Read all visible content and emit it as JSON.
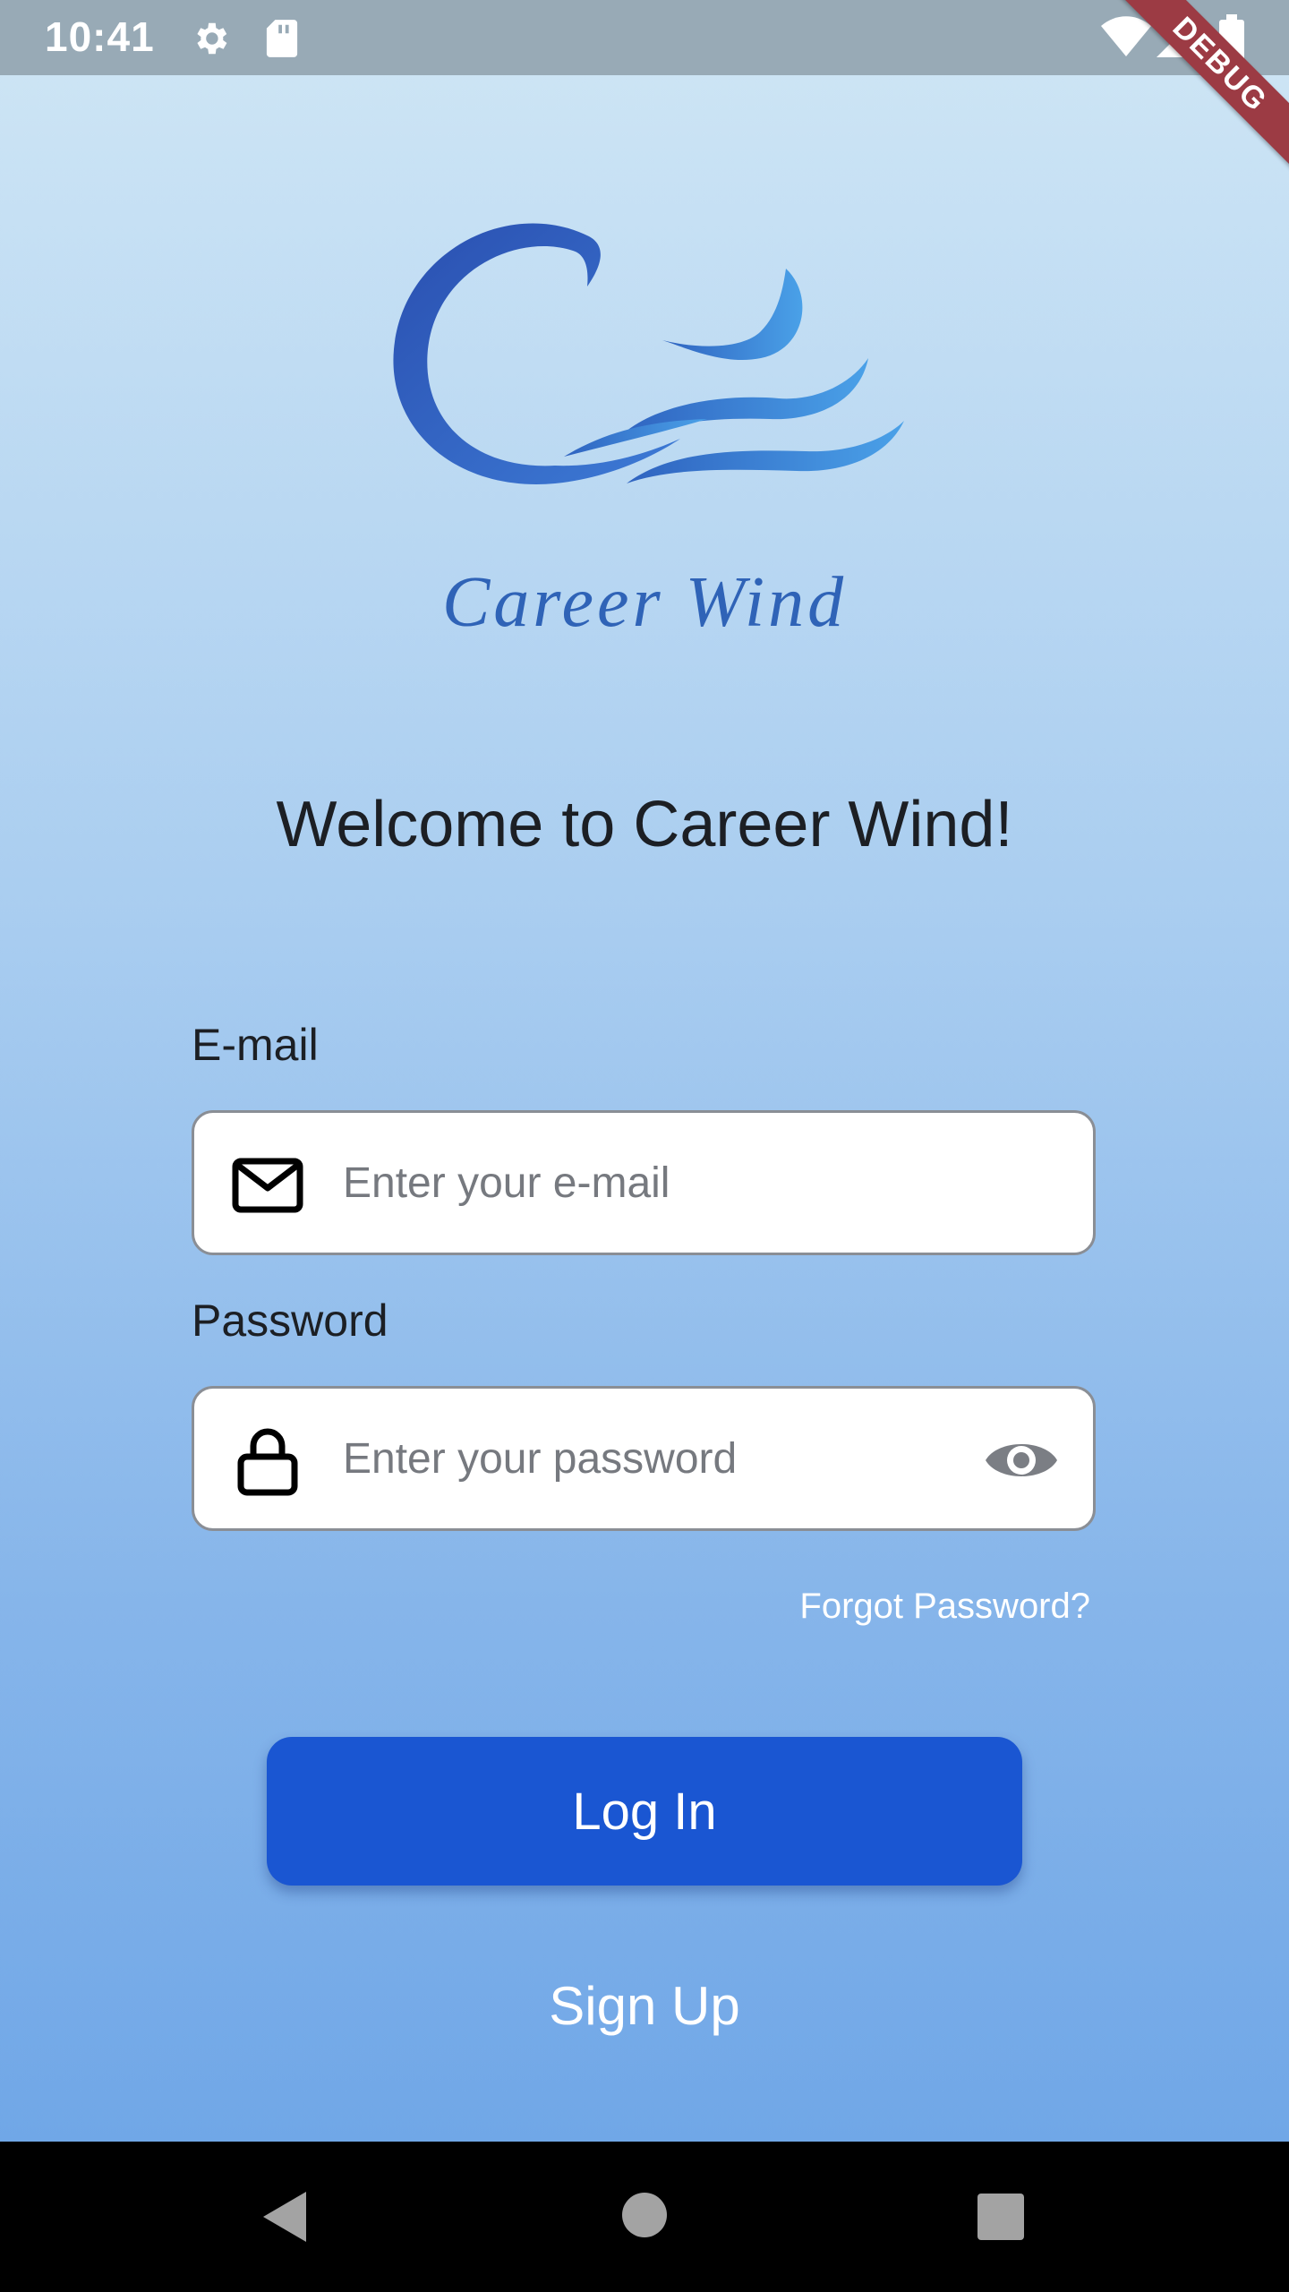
{
  "status_bar": {
    "time": "10:41",
    "icons": [
      "gear-icon",
      "sd-card-icon",
      "wifi-icon",
      "signal-icon",
      "battery-icon"
    ],
    "debug_banner": "DEBUG"
  },
  "branding": {
    "logo": "career-wind-logo",
    "name": "Career Wind"
  },
  "welcome_title": "Welcome to Career Wind!",
  "form": {
    "email": {
      "label": "E-mail",
      "placeholder": "Enter your e-mail",
      "value": "",
      "icon": "mail-icon"
    },
    "password": {
      "label": "Password",
      "placeholder": "Enter your password",
      "value": "",
      "icon": "lock-icon",
      "toggle_icon": "eye-icon"
    },
    "forgot_password": "Forgot Password?",
    "login_label": "Log In",
    "signup_label": "Sign Up"
  },
  "colors": {
    "primary": "#1a56d2",
    "brand_text": "#2f63b7",
    "status_bar": "#98aab6",
    "debug_ribbon": "#9c3b44"
  },
  "nav_bar": {
    "icons": [
      "back-icon",
      "home-icon",
      "recents-icon"
    ]
  }
}
